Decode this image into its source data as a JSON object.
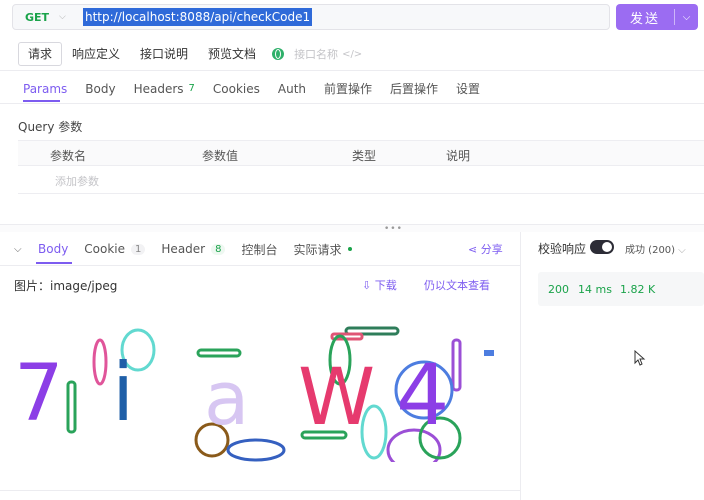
{
  "request": {
    "method": "GET",
    "url": "http://localhost:8088/api/checkCode1",
    "send_label": "发送"
  },
  "modes": {
    "tabs": [
      "请求",
      "响应定义",
      "接口说明",
      "预览文档"
    ],
    "active": 0,
    "name_placeholder": "接口名称"
  },
  "params_tabs": {
    "tabs": [
      {
        "label": "Params",
        "active": true
      },
      {
        "label": "Body"
      },
      {
        "label": "Headers",
        "count": "7"
      },
      {
        "label": "Cookies"
      },
      {
        "label": "Auth"
      },
      {
        "label": "前置操作"
      },
      {
        "label": "后置操作"
      },
      {
        "label": "设置"
      }
    ]
  },
  "query": {
    "title": "Query 参数",
    "columns": [
      "参数名",
      "参数值",
      "类型",
      "说明"
    ],
    "add_placeholder": "添加参数"
  },
  "response": {
    "tabs": [
      {
        "label": "Body",
        "active": true
      },
      {
        "label": "Cookie",
        "count": "1"
      },
      {
        "label": "Header",
        "count": "8"
      },
      {
        "label": "控制台"
      },
      {
        "label": "实际请求"
      }
    ],
    "share": "分享",
    "image_type": "图片：image/jpeg",
    "download": "下载",
    "view_as_text": "仍以文本查看",
    "captcha_chars": [
      "7",
      "i",
      "a",
      "W",
      "4"
    ]
  },
  "side": {
    "verify_label": "校验响应",
    "verify_on": true,
    "status_select": "成功 (200)",
    "status_code": "200",
    "time": "14 ms",
    "size": "1.82 K"
  },
  "colors": {
    "accent": "#7d5cf0",
    "send_bg": "#9b6cf2",
    "success": "#1aa34a",
    "url_selection": "#2f6ad9"
  }
}
